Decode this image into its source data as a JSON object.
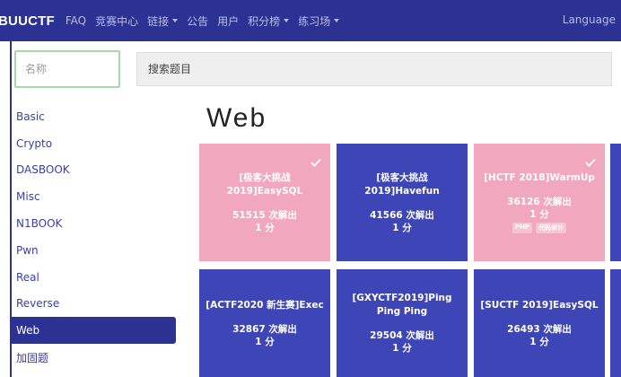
{
  "navbar": {
    "brand": "BUUCTF",
    "items": [
      {
        "label": "FAQ",
        "dropdown": false
      },
      {
        "label": "竞赛中心",
        "dropdown": false
      },
      {
        "label": "链接",
        "dropdown": true
      },
      {
        "label": "公告",
        "dropdown": false
      },
      {
        "label": "用户",
        "dropdown": false
      },
      {
        "label": "积分榜",
        "dropdown": true
      },
      {
        "label": "练习场",
        "dropdown": true
      }
    ],
    "language": "Language"
  },
  "filters": {
    "name_placeholder": "名称",
    "search_placeholder": "搜索题目"
  },
  "sidebar": {
    "categories": [
      "Basic",
      "Crypto",
      "DASBOOK",
      "Misc",
      "N1BOOK",
      "Pwn",
      "Real",
      "Reverse",
      "Web",
      "加固题"
    ],
    "active": "Web"
  },
  "section": {
    "title": "Web"
  },
  "challenges": [
    {
      "title": "[极客大挑战 2019]EasySQL",
      "solves": "51515 次解出",
      "score": "1 分",
      "solved": true,
      "color": "#f1a7bd",
      "tags": []
    },
    {
      "title": "[极客大挑战 2019]Havefun",
      "solves": "41566 次解出",
      "score": "1 分",
      "solved": false,
      "color": "#3e46b7",
      "tags": []
    },
    {
      "title": "[HCTF 2018]WarmUp",
      "solves": "36126 次解出",
      "score": "1 分",
      "solved": true,
      "color": "#f1a7bd",
      "tags": [
        "PHP",
        "代码审计"
      ]
    },
    {
      "title": "[ACTF2020 新生赛]Exec",
      "solves": "32867 次解出",
      "score": "1 分",
      "solved": false,
      "color": "#3e46b7",
      "tags": []
    },
    {
      "title": "[GXYCTF2019]Ping Ping Ping",
      "solves": "29504 次解出",
      "score": "1 分",
      "solved": false,
      "color": "#3e46b7",
      "tags": []
    },
    {
      "title": "[SUCTF 2019]EasySQL",
      "solves": "26493 次解出",
      "score": "1 分",
      "solved": false,
      "color": "#3e46b7",
      "tags": []
    }
  ],
  "colors": {
    "nav": "#2b3294",
    "card_blue": "#3e46b7",
    "card_pink": "#f1a7bd",
    "link": "#3940a4"
  }
}
